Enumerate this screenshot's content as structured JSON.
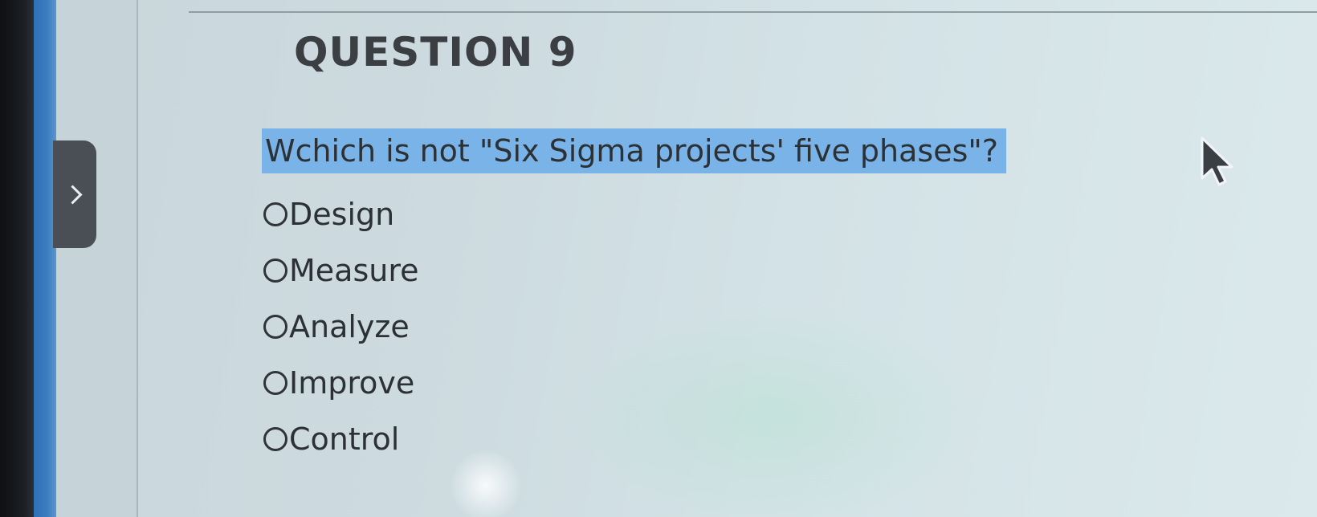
{
  "question": {
    "title": "QUESTION 9",
    "prompt": "Wchich is not \"Six Sigma projects' five phases\"?",
    "options": [
      {
        "label": "Design",
        "selected": false
      },
      {
        "label": "Measure",
        "selected": false
      },
      {
        "label": "Analyze",
        "selected": false
      },
      {
        "label": "Improve",
        "selected": false
      },
      {
        "label": "Control",
        "selected": false
      }
    ]
  },
  "icons": {
    "side_tab": "chevron-right-icon",
    "pointer": "mouse-cursor-icon"
  },
  "colors": {
    "highlight": "#7ab3e8",
    "text": "#2c3136",
    "side_strip": "#3c7cc0",
    "side_tab": "#4a4f55"
  }
}
